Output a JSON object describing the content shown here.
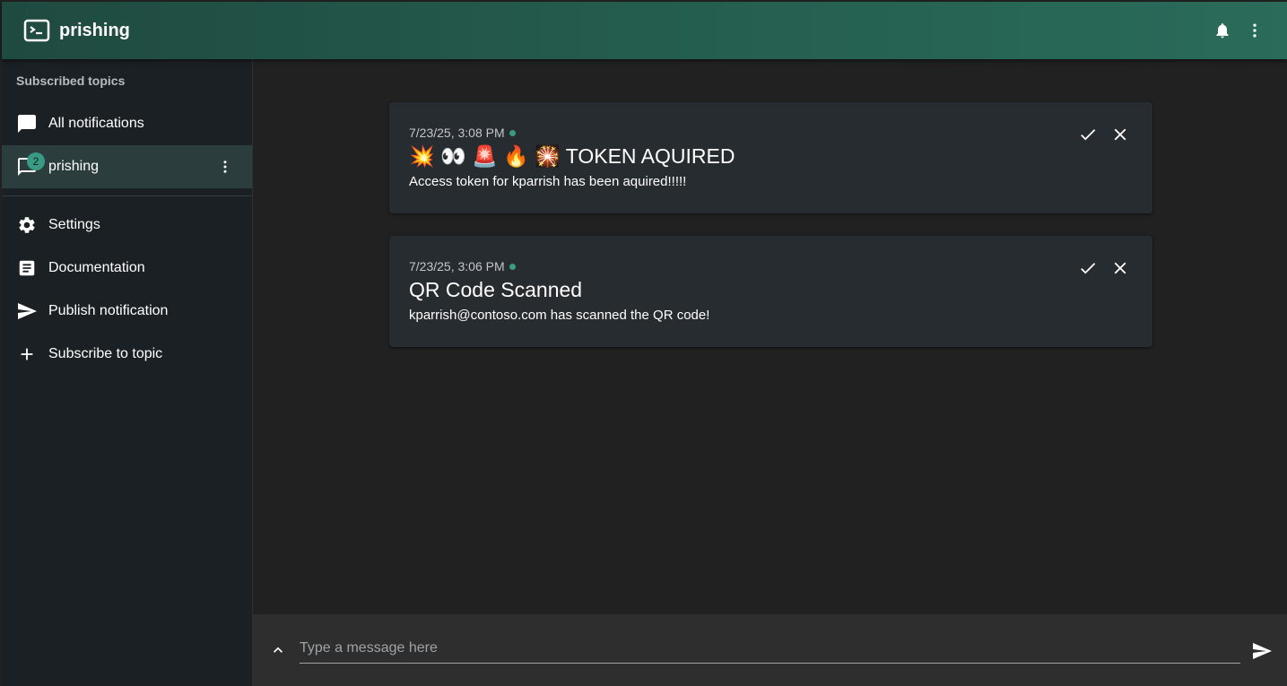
{
  "app": {
    "title": "prishing"
  },
  "header": {
    "icons": [
      "bell-icon",
      "more-vert-icon"
    ]
  },
  "sidebar": {
    "heading": "Subscribed topics",
    "topics": [
      {
        "label": "All notifications",
        "icon": "chat-icon"
      },
      {
        "label": "prishing",
        "icon": "chat-outline-icon",
        "badge": "2",
        "active": true
      }
    ],
    "items": [
      {
        "label": "Settings",
        "icon": "gear-icon"
      },
      {
        "label": "Documentation",
        "icon": "article-icon"
      },
      {
        "label": "Publish notification",
        "icon": "send-icon"
      },
      {
        "label": "Subscribe to topic",
        "icon": "plus-icon"
      }
    ]
  },
  "notifications": [
    {
      "time": "7/23/25, 3:08 PM",
      "title": "💥 👀 🚨 🔥 🎇 TOKEN AQUIRED",
      "body": "Access token for kparrish has been aquired!!!!!"
    },
    {
      "time": "7/23/25, 3:06 PM",
      "title": "QR Code Scanned",
      "body": "kparrish@contoso.com has scanned the QR code!"
    }
  ],
  "composer": {
    "placeholder": "Type a message here",
    "value": ""
  },
  "colors": {
    "accent": "#3a9b84",
    "header": "#256050",
    "sidebar": "#1b2024",
    "card": "#272c30"
  }
}
